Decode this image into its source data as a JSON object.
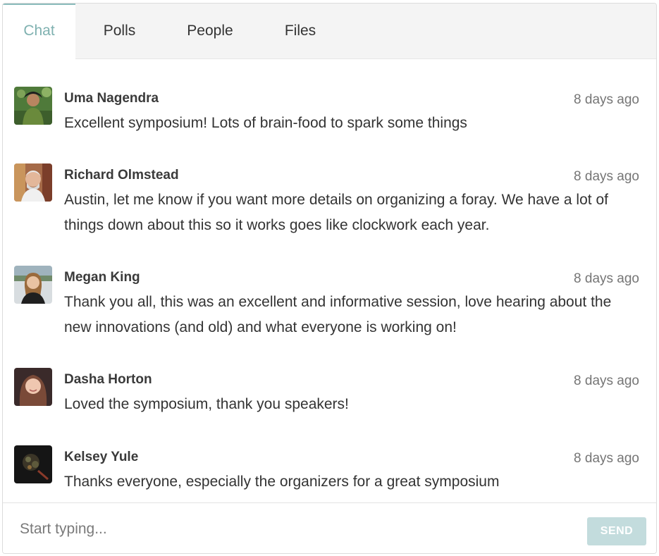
{
  "tabs": [
    {
      "label": "Chat",
      "active": true
    },
    {
      "label": "Polls",
      "active": false
    },
    {
      "label": "People",
      "active": false
    },
    {
      "label": "Files",
      "active": false
    }
  ],
  "messages": [
    {
      "name": "Uma Nagendra",
      "time": "8 days ago",
      "text": "Excellent symposium! Lots of brain-food to spark some things"
    },
    {
      "name": "Richard Olmstead",
      "time": "8 days ago",
      "text": "Austin, let me know if you want more details on organizing a foray. We have a lot of things down about this so it works goes like clockwork each year."
    },
    {
      "name": "Megan King",
      "time": "8 days ago",
      "text": "Thank you all, this was an excellent and informative session, love hearing about the new innovations (and old) and what everyone is working on!"
    },
    {
      "name": "Dasha Horton",
      "time": "8 days ago",
      "text": "Loved the symposium, thank you speakers!"
    },
    {
      "name": "Kelsey Yule",
      "time": "8 days ago",
      "text": "Thanks everyone, especially the organizers for a great symposium"
    }
  ],
  "composer": {
    "placeholder": "Start typing...",
    "send_label": "SEND"
  },
  "colors": {
    "accent": "#7fb1b0",
    "send_disabled": "#c3dcdd"
  }
}
